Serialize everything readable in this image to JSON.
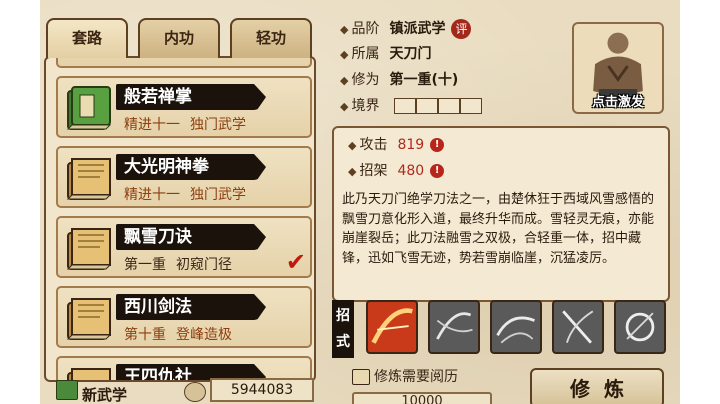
{
  "tabs": [
    {
      "label": "套路"
    },
    {
      "label": "内功"
    },
    {
      "label": "轻功"
    }
  ],
  "skills": [
    {
      "name": "般若禅掌",
      "level": "精进十一",
      "type": "独门武学",
      "book_color": "#4a8a3a"
    },
    {
      "name": "大光明神拳",
      "level": "精进十一",
      "type": "独门武学",
      "book_color": "#d8a64a"
    },
    {
      "name": "飘雪刀诀",
      "level": "第一重",
      "type": "初窥门径",
      "book_color": "#d8a64a"
    },
    {
      "name": "西川剑法",
      "level": "第十重",
      "type": "登峰造极",
      "book_color": "#d8a64a"
    },
    {
      "name": "王四仇社",
      "level": "",
      "type": "",
      "book_color": "#d8a64a"
    }
  ],
  "bottom": {
    "new_skill_label": "新武学",
    "money": "5944083"
  },
  "info": {
    "grade_label": "品阶",
    "grade_value": "镇派武学",
    "rate_badge": "评",
    "faction_label": "所属",
    "faction_value": "天刀门",
    "cultivation_label": "修为",
    "cultivation_value": "第一重(十)",
    "realm_label": "境界"
  },
  "portrait": {
    "label": "点击激发"
  },
  "stats": {
    "attack_label": "攻击",
    "attack_value": "819",
    "attack_warn": "!",
    "block_label": "招架",
    "block_value": "480",
    "block_warn": "!"
  },
  "description": "此乃天刀门绝学刀法之一，由楚休狂于西域风雪感悟的飘雪刀意化形入道，最终升华而成。雪轻灵无痕，亦能崩崖裂岳；此刀法融雪之双极，合轻重一体，招中藏锋，迅如飞雪无迹，势若雪崩临崖，沉猛凌厉。",
  "moves": {
    "label_1": "招",
    "label_2": "式",
    "items": [
      {
        "name": "move-1",
        "color": "#c83a1a"
      },
      {
        "name": "move-2",
        "color": "#6c6c6c"
      },
      {
        "name": "move-3",
        "color": "#5e5e5e"
      },
      {
        "name": "move-4",
        "color": "#666666"
      },
      {
        "name": "move-5",
        "color": "#5a5a5a"
      }
    ]
  },
  "requirement": {
    "label": "修炼需要阅历",
    "value": "10000"
  },
  "practice_button": "修炼"
}
